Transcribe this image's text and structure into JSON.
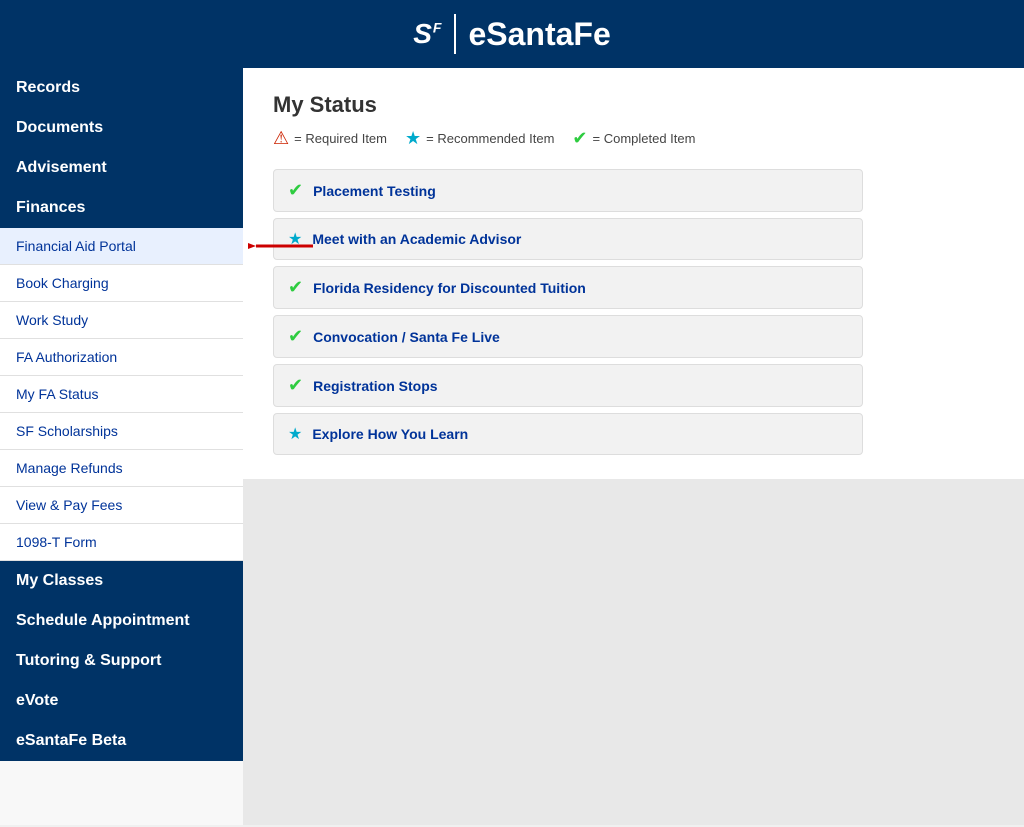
{
  "header": {
    "logo_text": "S",
    "logo_sub": "F",
    "title": "eSantaFe"
  },
  "sidebar": {
    "sections": [
      {
        "type": "header",
        "label": "Records",
        "id": "records"
      },
      {
        "type": "header",
        "label": "Documents",
        "id": "documents"
      },
      {
        "type": "header",
        "label": "Advisement",
        "id": "advisement"
      },
      {
        "type": "header",
        "label": "Finances",
        "id": "finances"
      },
      {
        "type": "item",
        "label": "Financial Aid Portal",
        "id": "financial-aid-portal",
        "active": true,
        "has_arrow": true
      },
      {
        "type": "item",
        "label": "Book Charging",
        "id": "book-charging"
      },
      {
        "type": "item",
        "label": "Work Study",
        "id": "work-study"
      },
      {
        "type": "item",
        "label": "FA Authorization",
        "id": "fa-authorization"
      },
      {
        "type": "item",
        "label": "My FA Status",
        "id": "my-fa-status"
      },
      {
        "type": "item",
        "label": "SF Scholarships",
        "id": "sf-scholarships"
      },
      {
        "type": "item",
        "label": "Manage Refunds",
        "id": "manage-refunds"
      },
      {
        "type": "item",
        "label": "View & Pay Fees",
        "id": "view-pay-fees"
      },
      {
        "type": "item",
        "label": "1098-T Form",
        "id": "1098-t-form"
      },
      {
        "type": "header",
        "label": "My Classes",
        "id": "my-classes"
      },
      {
        "type": "header",
        "label": "Schedule Appointment",
        "id": "schedule-appointment"
      },
      {
        "type": "header",
        "label": "Tutoring & Support",
        "id": "tutoring-support"
      },
      {
        "type": "header",
        "label": "eVote",
        "id": "evote"
      },
      {
        "type": "header",
        "label": "eSantaFe Beta",
        "id": "esantafe-beta"
      }
    ]
  },
  "content": {
    "title": "My Status",
    "legend": {
      "required_label": "= Required Item",
      "recommended_label": "= Recommended Item",
      "completed_label": "= Completed Item"
    },
    "status_items": [
      {
        "icon": "check",
        "text": "Placement Testing",
        "id": "placement-testing"
      },
      {
        "icon": "star",
        "text": "Meet with an Academic Advisor",
        "id": "academic-advisor"
      },
      {
        "icon": "check",
        "text": "Florida Residency for Discounted Tuition",
        "id": "florida-residency"
      },
      {
        "icon": "check",
        "text": "Convocation / Santa Fe Live",
        "id": "convocation"
      },
      {
        "icon": "check",
        "text": "Registration Stops",
        "id": "registration-stops"
      },
      {
        "icon": "star",
        "text": "Explore How You Learn",
        "id": "explore-learning"
      }
    ]
  },
  "arrow": {
    "direction": "left"
  }
}
